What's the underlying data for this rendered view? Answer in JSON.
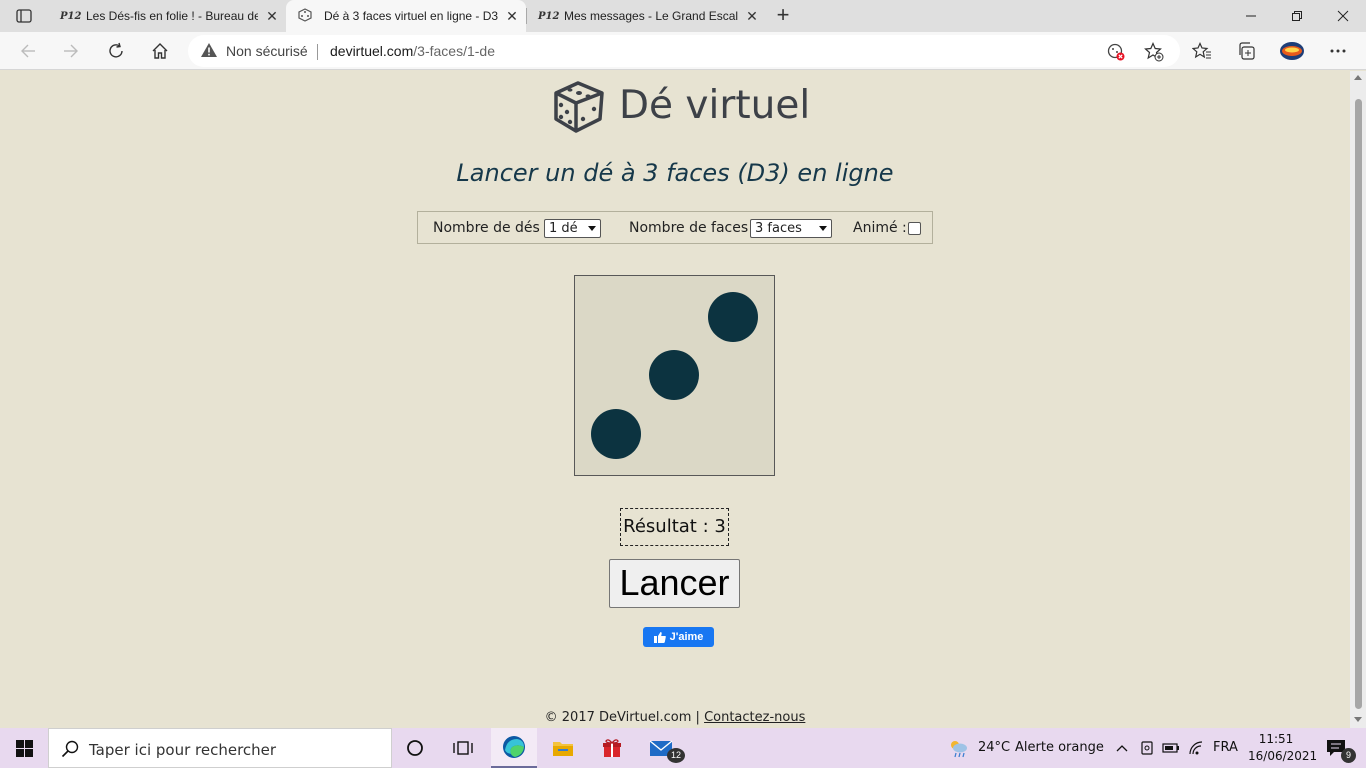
{
  "browser": {
    "tabs": [
      {
        "favicon": "P12",
        "title": "Les Dés-fis en folie ! - Bureau de",
        "active": false
      },
      {
        "favicon": "dice-icon",
        "title": "Dé à 3 faces virtuel en ligne - D3",
        "active": true
      },
      {
        "favicon": "P12",
        "title": "Mes messages - Le Grand Escalie",
        "active": false
      }
    ],
    "address": {
      "security_label": "Non sécurisé",
      "domain": "devirtuel.com",
      "path": "/3-faces/1-de"
    }
  },
  "page": {
    "site_title": "Dé virtuel",
    "subtitle": "Lancer un dé à 3 faces (D3) en ligne",
    "options": {
      "dice_count_label": "Nombre de dés :",
      "dice_count_value": "1 dé",
      "faces_label": "Nombre de faces :",
      "faces_value": "3 faces",
      "animated_label": "Animé :",
      "animated_checked": false
    },
    "die_value": 3,
    "result_text": "Résultat : 3",
    "roll_button": "Lancer",
    "like_button": "J'aime",
    "footer_copyright": "© 2017 DeVirtuel.com |",
    "footer_contact": "Contactez-nous"
  },
  "taskbar": {
    "search_placeholder": "Taper ici pour rechercher",
    "mail_badge": "12",
    "weather": "24°C",
    "weather_alert": "Alerte orange",
    "language": "FRA",
    "time": "11:51",
    "date": "16/06/2021",
    "notifications_count": "9"
  },
  "colors": {
    "page_bg": "#e7e3d2",
    "die_bg": "#dbd8c6",
    "pip": "#0c3340",
    "subtitle": "#16384a",
    "like_blue": "#1877f2"
  }
}
